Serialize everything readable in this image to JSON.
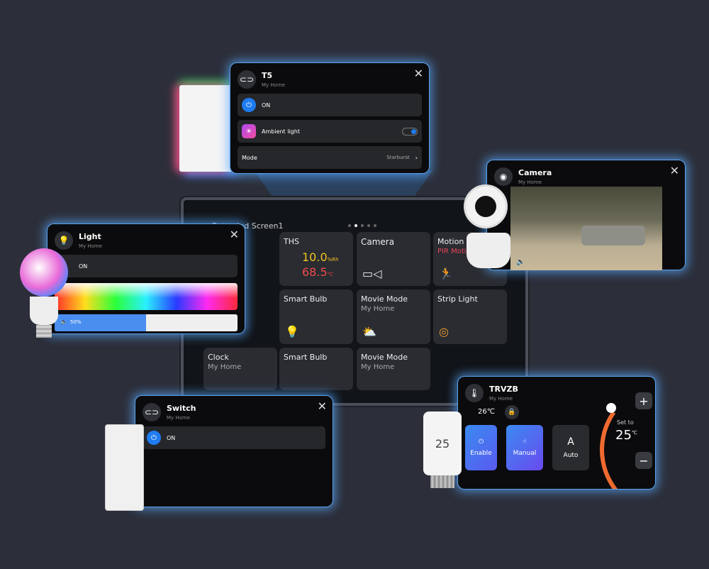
{
  "tablet": {
    "screen_title": "Extended Screen1",
    "page_dots": 5,
    "active_dot": 1,
    "tiles": [
      {
        "title": "THS",
        "humidity": "10.0",
        "humidity_unit": "%Rh",
        "temperature": "68.5",
        "temp_unit": "°C"
      },
      {
        "title": "Camera",
        "icon": "camera-icon"
      },
      {
        "title": "Motion Sensor",
        "subtitle": "PIR Motion",
        "icon": "motion-icon"
      },
      {
        "title": "Smart Bulb",
        "icon": "bulb-icon"
      },
      {
        "title": "Movie Mode",
        "subtitle": "My Home",
        "icon": "weather-icon"
      },
      {
        "title": "Strip Light",
        "icon": "strip-light-icon"
      },
      {
        "title": "Clock",
        "subtitle": "My Home"
      },
      {
        "title": "Smart Bulb"
      },
      {
        "title": "Movie Mode",
        "subtitle": "My Home"
      }
    ]
  },
  "t5": {
    "title": "T5",
    "subtitle": "My Home",
    "on_label": "ON",
    "ambient_label": "Ambient light",
    "ambient_on": true,
    "mode_label": "Mode",
    "mode_value": "Starburst"
  },
  "camera": {
    "title": "Camera",
    "subtitle": "My Home"
  },
  "light": {
    "title": "Light",
    "subtitle": "My Home",
    "on_label": "ON",
    "brightness": "50%",
    "brightness_value": 50
  },
  "switch": {
    "title": "Switch",
    "subtitle": "My Home",
    "on_label": "ON"
  },
  "trvzb": {
    "title": "TRVZB",
    "subtitle": "My Home",
    "current_temp": "26℃",
    "set_label": "Set to",
    "set_temp": "25",
    "set_unit": "℃",
    "enable": "Enable",
    "manual": "Manual",
    "auto": "Auto",
    "auto_glyph": "A",
    "device_display": "25"
  },
  "colors": {
    "accent": "#1f7cf0",
    "humidity": "#f2c321",
    "temperature": "#ef4a4a",
    "motion": "#e8455a",
    "glow": "#5aa0e8"
  }
}
